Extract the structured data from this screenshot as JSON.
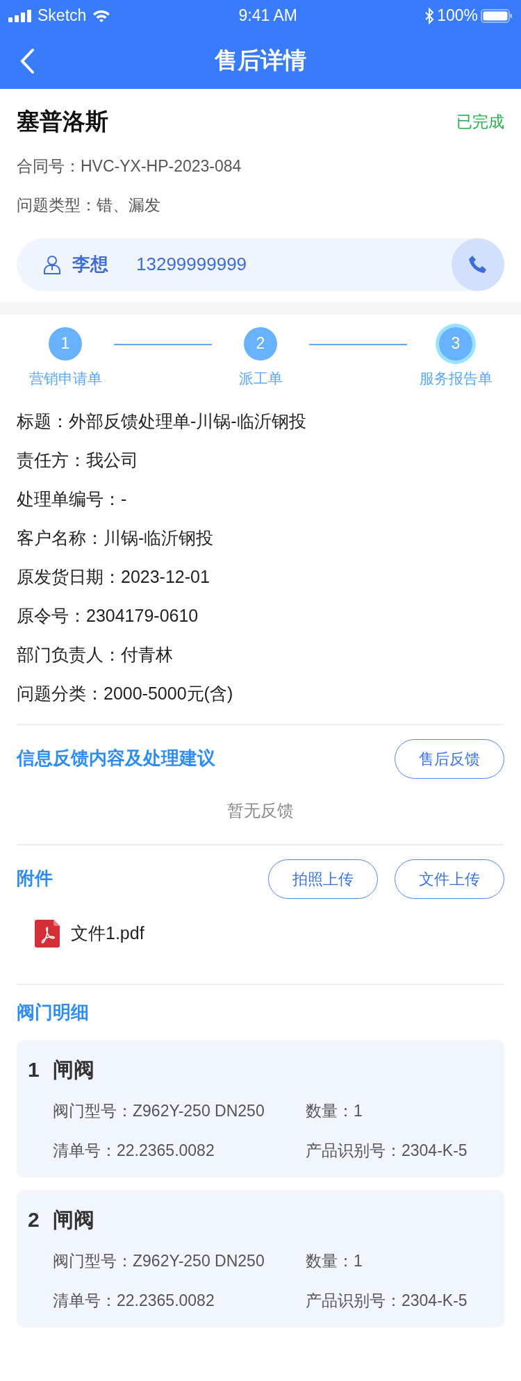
{
  "status_bar": {
    "carrier": "Sketch",
    "time": "9:41 AM",
    "battery": "100%"
  },
  "nav": {
    "title": "售后详情"
  },
  "header": {
    "company": "塞普洛斯",
    "status": "已完成",
    "lines": [
      {
        "label": "合同号：",
        "value": "HVC-YX-HP-2023-084"
      },
      {
        "label": "问题类型：",
        "value": "错、漏发"
      }
    ],
    "contact": {
      "name": "李想",
      "phone": "13299999999"
    }
  },
  "steps": [
    {
      "number": "1",
      "label": "营销申请单",
      "current": false
    },
    {
      "number": "2",
      "label": "派工单",
      "current": false
    },
    {
      "number": "3",
      "label": "服务报告单",
      "current": true
    }
  ],
  "details": [
    {
      "label": "标题：",
      "value": "外部反馈处理单-川锅-临沂钢投"
    },
    {
      "label": "责任方：",
      "value": "我公司"
    },
    {
      "label": "处理单编号：",
      "value": "-"
    },
    {
      "label": "客户名称：",
      "value": "川锅-临沂钢投"
    },
    {
      "label": "原发货日期：",
      "value": "2023-12-01"
    },
    {
      "label": "原令号：",
      "value": "2304179-0610"
    },
    {
      "label": "部门负责人：",
      "value": "付青林"
    },
    {
      "label": "问题分类：",
      "value": "2000-5000元(含)"
    }
  ],
  "feedback": {
    "title": "信息反馈内容及处理建议",
    "button": "售后反馈",
    "empty": "暂无反馈"
  },
  "attachments": {
    "title": "附件",
    "buttons": [
      "拍照上传",
      "文件上传"
    ],
    "files": [
      {
        "name": "文件1.pdf"
      }
    ]
  },
  "valves": {
    "title": "阀门明细",
    "items": [
      {
        "index": "1",
        "name": "闸阀",
        "fields": [
          {
            "label": "阀门型号：",
            "value": "Z962Y-250 DN250"
          },
          {
            "label": "数量：",
            "value": "1"
          },
          {
            "label": "清单号：",
            "value": "22.2365.0082"
          },
          {
            "label": "产品识别号：",
            "value": "2304-K-5"
          }
        ]
      },
      {
        "index": "2",
        "name": "闸阀",
        "fields": [
          {
            "label": "阀门型号：",
            "value": "Z962Y-250 DN250"
          },
          {
            "label": "数量：",
            "value": "1"
          },
          {
            "label": "清单号：",
            "value": "22.2365.0082"
          },
          {
            "label": "产品识别号：",
            "value": "2304-K-5"
          }
        ]
      }
    ]
  }
}
